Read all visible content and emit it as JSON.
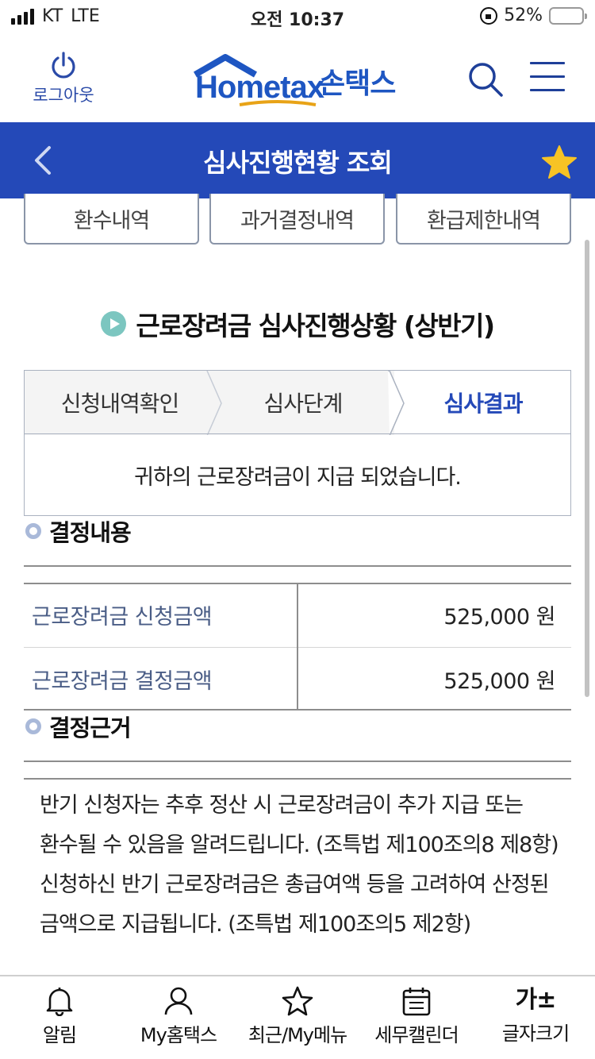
{
  "status_bar": {
    "carrier": "KT",
    "network": "LTE",
    "time": "오전 10:37",
    "battery": "52%",
    "battery_level": 0.52
  },
  "header": {
    "logout_label": "로그아웃",
    "logo_text": "Hometax",
    "logo_kr": "손택스",
    "brand_color": "#1e56c2"
  },
  "titlebar": {
    "title": "심사진행현황 조회",
    "bg_color": "#2449b8",
    "star_color": "#f7c325"
  },
  "top_tabs": [
    {
      "label": "환수내역"
    },
    {
      "label": "과거결정내역"
    },
    {
      "label": "환급제한내역"
    }
  ],
  "section": {
    "title": "근로장려금 심사진행상황 (상반기)"
  },
  "steps": [
    {
      "label": "신청내역확인"
    },
    {
      "label": "심사단계"
    },
    {
      "label": "심사결과"
    }
  ],
  "result_message": "귀하의 근로장려금이 지급 되었습니다.",
  "decision": {
    "title": "결정내용",
    "rows": [
      {
        "label": "근로장려금 신청금액",
        "value": "525,000 원"
      },
      {
        "label": "근로장려금 결정금액",
        "value": "525,000 원"
      }
    ]
  },
  "basis": {
    "title": "결정근거",
    "text": "반기 신청자는 추후 정산 시 근로장려금이 추가 지급 또는 환수될 수 있음을 알려드립니다. (조특법 제100조의8 제8항) 신청하신 반기 근로장려금은 총급여액 등을 고려하여 산정된 금액으로 지급됩니다. (조특법 제100조의5 제2항)"
  },
  "bottom_nav": [
    {
      "label": "알림",
      "icon": "bell-icon"
    },
    {
      "label": "My홈택스",
      "icon": "person-icon"
    },
    {
      "label": "최근/My메뉴",
      "icon": "star-outline-icon"
    },
    {
      "label": "세무캘린더",
      "icon": "calendar-icon"
    },
    {
      "label": "글자크기",
      "icon": "font-size-icon",
      "icon_text": "가±"
    }
  ]
}
